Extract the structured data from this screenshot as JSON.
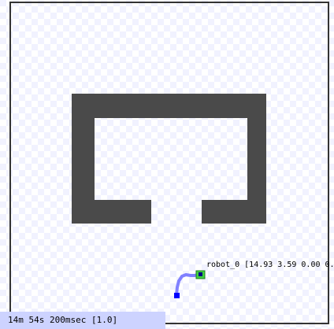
{
  "robot": {
    "label": "robot_0 [14.93 3.59 0.00 0.",
    "color": "#3fd13f",
    "trail_color": "#8080ff",
    "start_marker_color": "#0000ff"
  },
  "status_bar": {
    "text": "14m 54s 200msec [1.0]",
    "background": "#cdd3ff"
  },
  "map": {
    "obstacle_color": "#4a4a4a",
    "border_color": "#333333",
    "grid_color": "#e6e8ff",
    "background": "#ffffff"
  }
}
